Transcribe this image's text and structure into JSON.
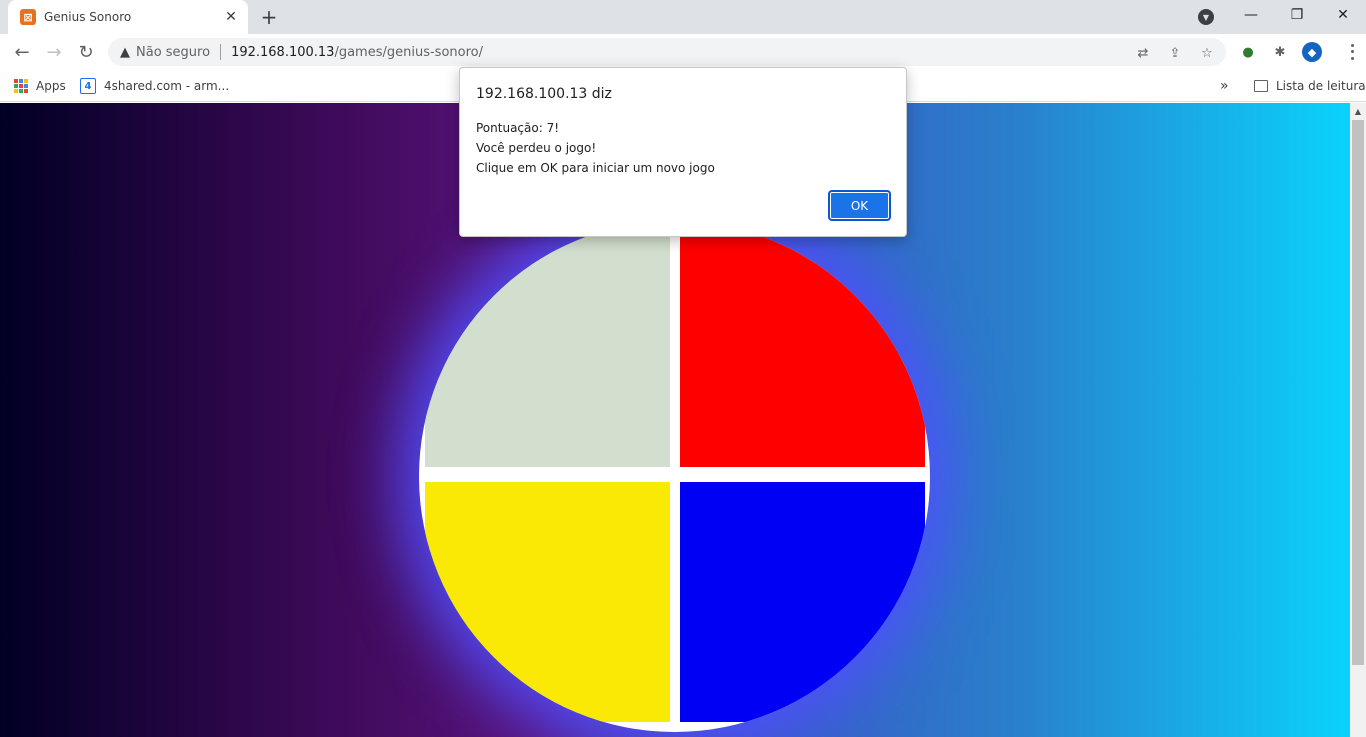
{
  "browser": {
    "tab": {
      "title": "Genius Sonoro",
      "favicon": "xampp-icon"
    },
    "address": {
      "security_label": "Não seguro",
      "host": "192.168.100.13",
      "path": "/games/genius-sonoro/"
    },
    "bookmarks": {
      "apps_label": "Apps",
      "item1": "4shared.com - arm...",
      "reading_list": "Lista de leitura",
      "overflow": "»"
    }
  },
  "dialog": {
    "title": "192.168.100.13 diz",
    "line1": "Pontuação: 7!",
    "line2": "Você perdeu o jogo!",
    "line3": "Clique em OK para iniciar um novo jogo",
    "ok_label": "OK"
  },
  "game": {
    "quadrants": [
      {
        "name": "green",
        "color": "#d3dfce"
      },
      {
        "name": "red",
        "color": "#fe0000"
      },
      {
        "name": "yellow",
        "color": "#f9e904"
      },
      {
        "name": "blue",
        "color": "#0000f5"
      }
    ]
  },
  "colors": {
    "accent": "#1a73e8",
    "glow": "#5050ff"
  }
}
